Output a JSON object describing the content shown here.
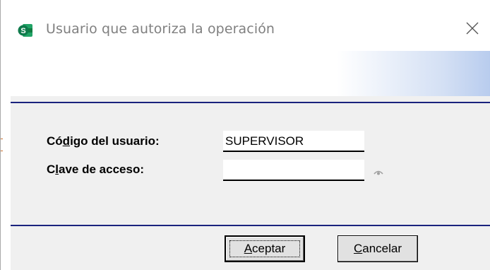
{
  "window": {
    "title": "Usuario que autoriza la operación",
    "app_icon": "sheets-s-icon",
    "close_icon": "close-icon"
  },
  "form": {
    "user_code": {
      "label_before": "Có",
      "label_mnemonic": "d",
      "label_after": "igo del usuario:",
      "value": "SUPERVISOR"
    },
    "password": {
      "label_before": "C",
      "label_mnemonic": "l",
      "label_after": "ave de acceso:",
      "value": "",
      "reveal_icon": "eye-icon"
    }
  },
  "buttons": {
    "accept": {
      "mnemonic": "A",
      "rest": "ceptar"
    },
    "cancel": {
      "mnemonic": "C",
      "rest": "ancelar"
    }
  },
  "colors": {
    "rule": "#1a237e",
    "header_gradient_end": "#b8ccee",
    "app_icon_green": "#0f7b4c"
  }
}
